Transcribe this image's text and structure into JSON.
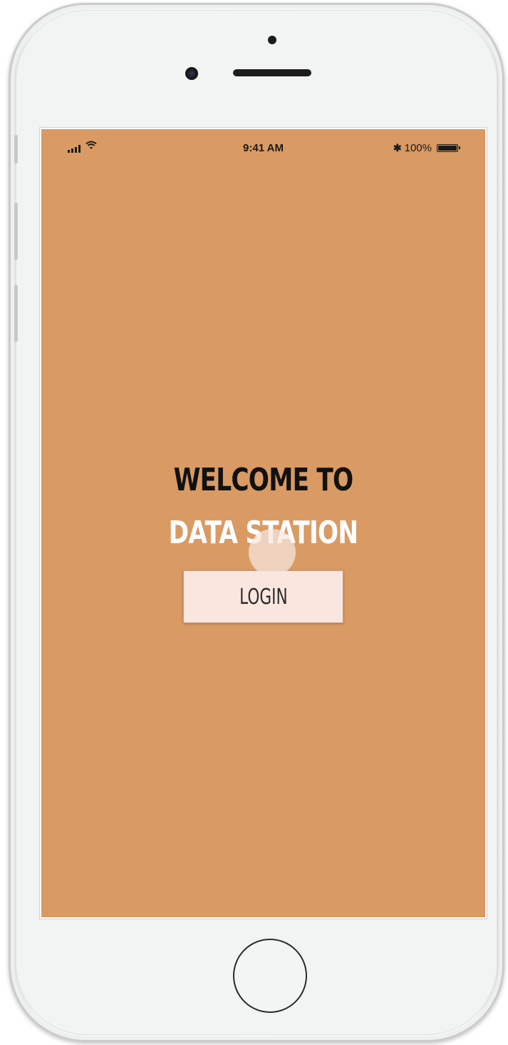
{
  "status_bar": {
    "time": "9:41 AM",
    "battery": "100%",
    "battery_level": 1.0,
    "signal_icon": "signal-bars-icon",
    "wifi_icon": "wifi-icon",
    "bluetooth_icon": "bluetooth-icon"
  },
  "main": {
    "welcome_line": "WELCOME TO",
    "brand_line": "DATA STATION",
    "login_label": "LOGIN"
  },
  "colors": {
    "screen_background": "#d99a64",
    "login_button_background": "#f9e6de",
    "welcome_text": "#111111",
    "brand_text": "#ffffff"
  }
}
